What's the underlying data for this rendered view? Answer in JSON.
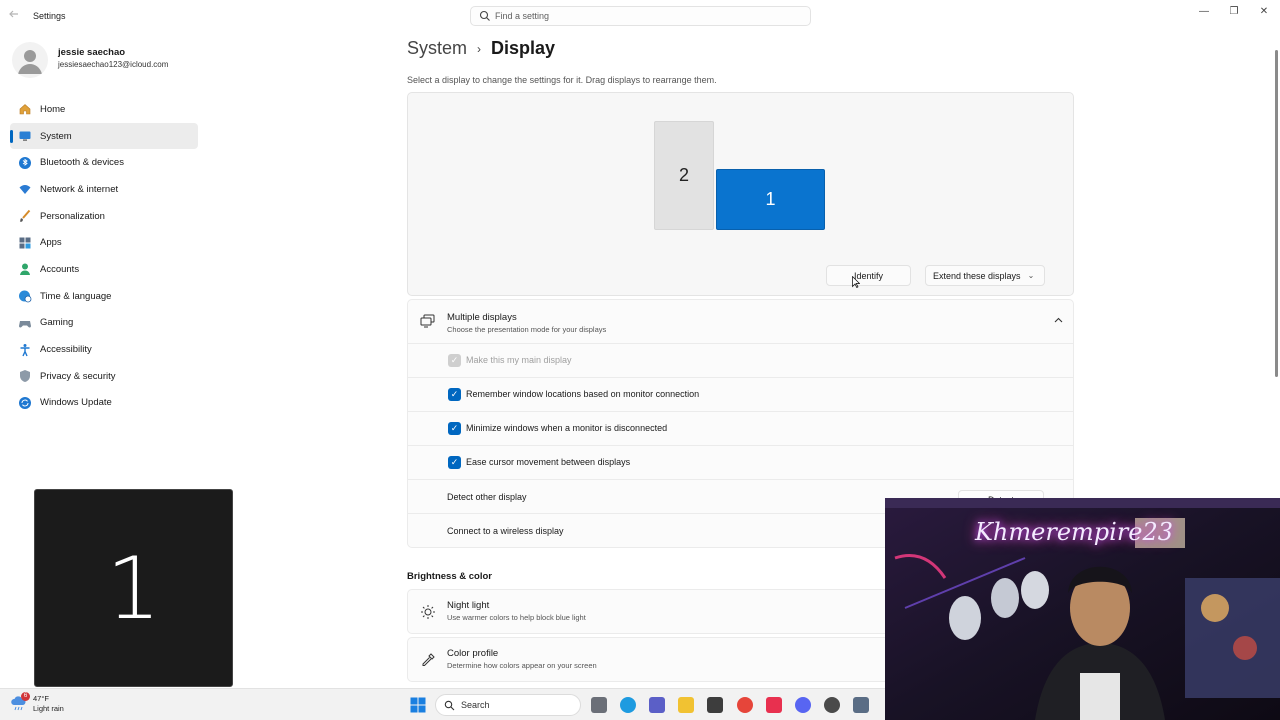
{
  "window": {
    "app_title": "Settings",
    "search_placeholder": "Find a setting",
    "minimize": "—",
    "maximize": "❐",
    "close": "✕"
  },
  "profile": {
    "name": "jessie saechao",
    "email": "jessiesaechao123@icloud.com"
  },
  "nav": {
    "items": [
      {
        "label": "Home",
        "icon": "home-icon",
        "selected": false
      },
      {
        "label": "System",
        "icon": "monitor-icon",
        "selected": true
      },
      {
        "label": "Bluetooth & devices",
        "icon": "bluetooth-icon",
        "selected": false
      },
      {
        "label": "Network & internet",
        "icon": "wifi-icon",
        "selected": false
      },
      {
        "label": "Personalization",
        "icon": "brush-icon",
        "selected": false
      },
      {
        "label": "Apps",
        "icon": "apps-icon",
        "selected": false
      },
      {
        "label": "Accounts",
        "icon": "accounts-icon",
        "selected": false
      },
      {
        "label": "Time & language",
        "icon": "globe-clock-icon",
        "selected": false
      },
      {
        "label": "Gaming",
        "icon": "gamepad-icon",
        "selected": false
      },
      {
        "label": "Accessibility",
        "icon": "accessibility-icon",
        "selected": false
      },
      {
        "label": "Privacy & security",
        "icon": "shield-icon",
        "selected": false
      },
      {
        "label": "Windows Update",
        "icon": "update-icon",
        "selected": false
      }
    ]
  },
  "identify_overlay": {
    "number": "1"
  },
  "main": {
    "breadcrumb_parent": "System",
    "breadcrumb_separator": "›",
    "breadcrumb_current": "Display",
    "hint": "Select a display to change the settings for it. Drag displays to rearrange them.",
    "monitors": [
      {
        "number": "2",
        "selected": false
      },
      {
        "number": "1",
        "selected": true
      }
    ],
    "identify_button": "Identify",
    "extend_select": "Extend these displays"
  },
  "multiple_displays": {
    "title": "Multiple displays",
    "subtitle": "Choose the presentation mode for your displays",
    "options": [
      {
        "label": "Make this my main display",
        "checked": true,
        "disabled": true
      },
      {
        "label": "Remember window locations based on monitor connection",
        "checked": true,
        "disabled": false
      },
      {
        "label": "Minimize windows when a monitor is disconnected",
        "checked": true,
        "disabled": false
      },
      {
        "label": "Ease cursor movement between displays",
        "checked": true,
        "disabled": false
      }
    ],
    "detect_label": "Detect other display",
    "detect_button": "Detect",
    "wireless_label": "Connect to a wireless display"
  },
  "brightness_color": {
    "title": "Brightness & color",
    "items": [
      {
        "name": "Night light",
        "description": "Use warmer colors to help block blue light",
        "icon": "sun-icon"
      },
      {
        "name": "Color profile",
        "description": "Determine how colors appear on your screen",
        "icon": "eyedropper-icon"
      }
    ]
  },
  "webcam": {
    "brand_text": "Khmerempire23"
  },
  "taskbar": {
    "weather_temp": "47°F",
    "weather_desc": "Light rain",
    "weather_badge": "6",
    "search_label": "Search"
  },
  "colors": {
    "accent": "#0067c0",
    "monitor_selected": "#0a74cf"
  }
}
